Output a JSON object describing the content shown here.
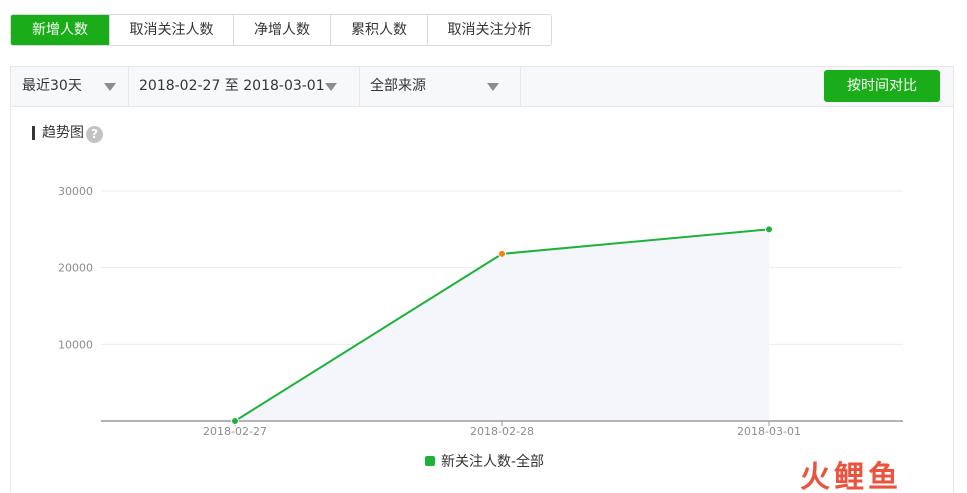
{
  "tabs": [
    {
      "label": "新增人数",
      "active": true
    },
    {
      "label": "取消关注人数",
      "active": false
    },
    {
      "label": "净增人数",
      "active": false
    },
    {
      "label": "累积人数",
      "active": false
    },
    {
      "label": "取消关注分析",
      "active": false
    }
  ],
  "filters": {
    "period": "最近30天",
    "date_range": "2018-02-27 至 2018-03-01",
    "source": "全部来源",
    "compare_button": "按时间对比"
  },
  "trend": {
    "title": "趋势图",
    "help_icon": "?"
  },
  "colors": {
    "accent": "#1aad19",
    "line": "#1db33a",
    "highlight_point": "#f0850a",
    "area": "#f4f6fb"
  },
  "chart_data": {
    "type": "line",
    "x": [
      "2018-02-27",
      "2018-02-28",
      "2018-03-01"
    ],
    "series": [
      {
        "name": "新关注人数-全部",
        "values": [
          0,
          21800,
          25000
        ]
      }
    ],
    "yticks": [
      10000,
      20000,
      30000
    ],
    "ylim": [
      0,
      30000
    ],
    "grid": true,
    "legend": "bottom-center"
  },
  "watermark": "火鲤鱼"
}
